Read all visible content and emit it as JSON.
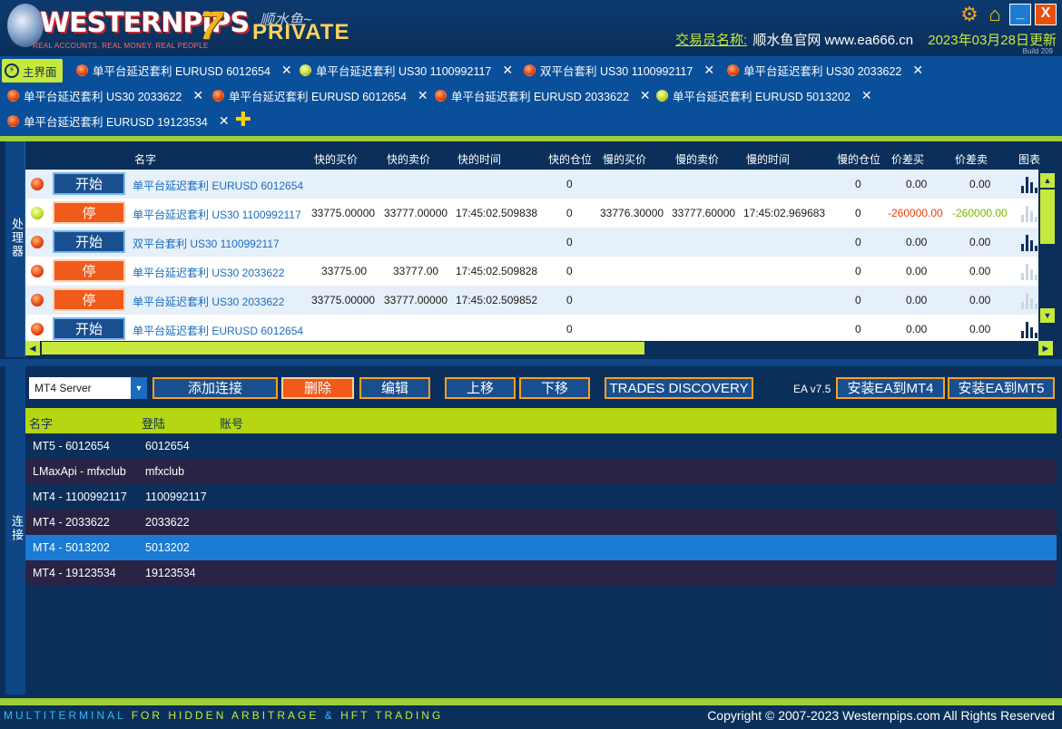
{
  "header": {
    "brand": "WESTERNPIPS",
    "tagline": "REAL ACCOUNTS, REAL MONEY, REAL PEOPLE",
    "version_mark": "7",
    "edition": "PRIVATE",
    "shunshui": "顺水鱼~",
    "trader_label": "交易员名称:",
    "trader_site": "顺水鱼官网 www.ea666.cn",
    "update_date": "2023年03月28日更新",
    "build": "Build 209",
    "minimize": "_",
    "close": "X"
  },
  "tabs": {
    "main_label": "主界面",
    "items": [
      {
        "label": "单平台延迟套利 EURUSD 6012654",
        "status": "red"
      },
      {
        "label": "单平台延迟套利 US30 1100992117",
        "status": "yellow"
      },
      {
        "label": "双平台套利 US30 1100992117",
        "status": "red"
      },
      {
        "label": "单平台延迟套利 US30 2033622",
        "status": "red"
      },
      {
        "label": "单平台延迟套利 US30 2033622",
        "status": "red"
      },
      {
        "label": "单平台延迟套利 EURUSD 6012654",
        "status": "red"
      },
      {
        "label": "单平台延迟套利 EURUSD 2033622",
        "status": "red"
      },
      {
        "label": "单平台延迟套利 EURUSD 5013202",
        "status": "yellow"
      },
      {
        "label": "单平台延迟套利 EURUSD 19123534",
        "status": "red"
      }
    ],
    "close_glyph": "✕",
    "add_glyph": "✚"
  },
  "processor": {
    "side_label": "处理器",
    "columns": {
      "name": "名字",
      "fast_bid": "快的买价",
      "fast_ask": "快的卖价",
      "fast_time": "快的时间",
      "fast_pos": "快的仓位",
      "slow_bid": "慢的买价",
      "slow_ask": "慢的卖价",
      "slow_time": "慢的时间",
      "slow_pos": "慢的仓位",
      "spread_buy": "价差买",
      "spread_sell": "价差卖",
      "chart": "图表"
    },
    "rows": [
      {
        "status": "red",
        "action": "开始",
        "name": "单平台延迟套利 EURUSD 6012654",
        "fast_bid": "",
        "fast_ask": "",
        "fast_time": "",
        "fast_pos": "0",
        "slow_bid": "",
        "slow_ask": "",
        "slow_time": "",
        "slow_pos": "0",
        "spread_buy": "0.00",
        "spread_sell": "0.00"
      },
      {
        "status": "yellow",
        "action": "停",
        "name": "单平台延迟套利 US30 1100992117",
        "fast_bid": "33775.00000",
        "fast_ask": "33777.00000",
        "fast_time": "17:45:02.509838",
        "fast_pos": "0",
        "slow_bid": "33776.30000",
        "slow_ask": "33777.60000",
        "slow_time": "17:45:02.969683",
        "slow_pos": "0",
        "spread_buy": "-260000.00",
        "spread_sell": "-260000.00"
      },
      {
        "status": "red",
        "action": "开始",
        "name": "双平台套利 US30 1100992117",
        "fast_bid": "",
        "fast_ask": "",
        "fast_time": "",
        "fast_pos": "0",
        "slow_bid": "",
        "slow_ask": "",
        "slow_time": "",
        "slow_pos": "0",
        "spread_buy": "0.00",
        "spread_sell": "0.00"
      },
      {
        "status": "red",
        "action": "停",
        "name": "单平台延迟套利 US30 2033622",
        "fast_bid": "33775.00",
        "fast_ask": "33777.00",
        "fast_time": "17:45:02.509828",
        "fast_pos": "0",
        "slow_bid": "",
        "slow_ask": "",
        "slow_time": "",
        "slow_pos": "0",
        "spread_buy": "0.00",
        "spread_sell": "0.00"
      },
      {
        "status": "red",
        "action": "停",
        "name": "单平台延迟套利 US30 2033622",
        "fast_bid": "33775.00000",
        "fast_ask": "33777.00000",
        "fast_time": "17:45:02.509852",
        "fast_pos": "0",
        "slow_bid": "",
        "slow_ask": "",
        "slow_time": "",
        "slow_pos": "0",
        "spread_buy": "0.00",
        "spread_sell": "0.00"
      },
      {
        "status": "red",
        "action": "开始",
        "name": "单平台延迟套利 EURUSD 6012654",
        "fast_bid": "",
        "fast_ask": "",
        "fast_time": "",
        "fast_pos": "0",
        "slow_bid": "",
        "slow_ask": "",
        "slow_time": "",
        "slow_pos": "0",
        "spread_buy": "0.00",
        "spread_sell": "0.00"
      }
    ]
  },
  "connections": {
    "side_label": "连接",
    "server_select": "MT4 Server",
    "buttons": {
      "add": "添加连接",
      "delete": "删除",
      "edit": "编辑",
      "move_up": "上移",
      "move_down": "下移",
      "discovery": "TRADES DISCOVERY",
      "install_mt4": "安装EA到MT4",
      "install_mt5": "安装EA到MT5"
    },
    "ea_version": "EA v7.5",
    "columns": {
      "name": "名字",
      "login": "登陆",
      "account": "账号"
    },
    "rows": [
      {
        "name": "MT5 - 6012654",
        "login": "6012654"
      },
      {
        "name": "LMaxApi - mfxclub",
        "login": "mfxclub"
      },
      {
        "name": "MT4 - 1100992117",
        "login": "1100992117"
      },
      {
        "name": "MT4 - 2033622",
        "login": "2033622"
      },
      {
        "name": "MT4 - 5013202",
        "login": "5013202"
      },
      {
        "name": "MT4 - 19123534",
        "login": "19123534"
      }
    ]
  },
  "footer": {
    "tag_a": "MULTITERMINAL",
    "tag_b": "FOR HIDDEN ARBITRAGE",
    "tag_c": "&",
    "tag_d": "HFT TRADING",
    "copyright": "Copyright © 2007-2023 Westernpips.com All Rights Reserved"
  },
  "colors": {
    "accent": "#c7e83c",
    "panel": "#0a2f5a",
    "stop": "#f05a1a",
    "tabbar": "#0a4f9a"
  }
}
